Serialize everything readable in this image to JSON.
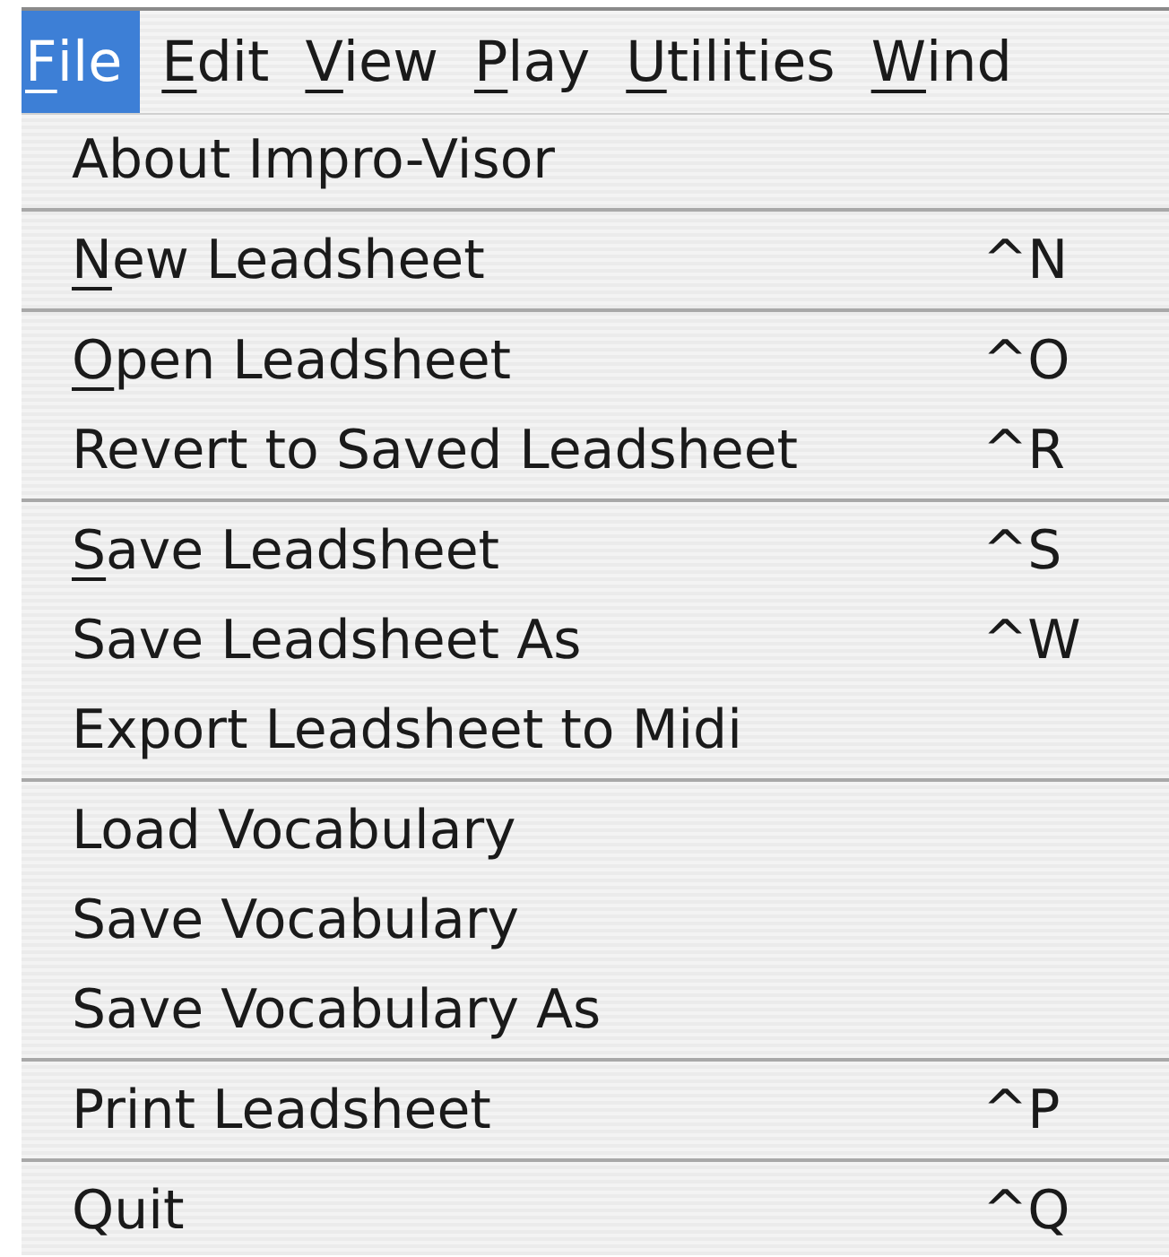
{
  "menubar": [
    {
      "label_underlined": "F",
      "label_rest": "ile",
      "selected": true
    },
    {
      "label_underlined": "E",
      "label_rest": "dit",
      "selected": false
    },
    {
      "label_underlined": "V",
      "label_rest": "iew",
      "selected": false
    },
    {
      "label_underlined": "P",
      "label_rest": "lay",
      "selected": false
    },
    {
      "label_underlined": "U",
      "label_rest": "tilities",
      "selected": false
    },
    {
      "label_underlined": "W",
      "label_rest": "ind",
      "selected": false
    }
  ],
  "menu": [
    {
      "kind": "item",
      "label": "About Impro-Visor"
    },
    {
      "kind": "separator"
    },
    {
      "kind": "item",
      "label_underlined": "N",
      "label_rest": "ew Leadsheet",
      "shortcut": "^N"
    },
    {
      "kind": "separator"
    },
    {
      "kind": "item",
      "label_underlined": "O",
      "label_rest": "pen Leadsheet",
      "shortcut": "^O"
    },
    {
      "kind": "item",
      "label": "Revert to Saved Leadsheet",
      "shortcut": "^R"
    },
    {
      "kind": "separator"
    },
    {
      "kind": "item",
      "label_underlined": "S",
      "label_rest": "ave Leadsheet",
      "shortcut": "^S"
    },
    {
      "kind": "item",
      "label": "Save Leadsheet As",
      "shortcut": "^W"
    },
    {
      "kind": "item",
      "label": "Export Leadsheet to Midi"
    },
    {
      "kind": "separator"
    },
    {
      "kind": "item",
      "label": "Load Vocabulary"
    },
    {
      "kind": "item",
      "label": "Save Vocabulary"
    },
    {
      "kind": "item",
      "label": "Save Vocabulary As"
    },
    {
      "kind": "separator"
    },
    {
      "kind": "item",
      "label": "Print Leadsheet",
      "shortcut": "^P"
    },
    {
      "kind": "separator"
    },
    {
      "kind": "item",
      "label": "Quit",
      "shortcut": "^Q"
    }
  ]
}
